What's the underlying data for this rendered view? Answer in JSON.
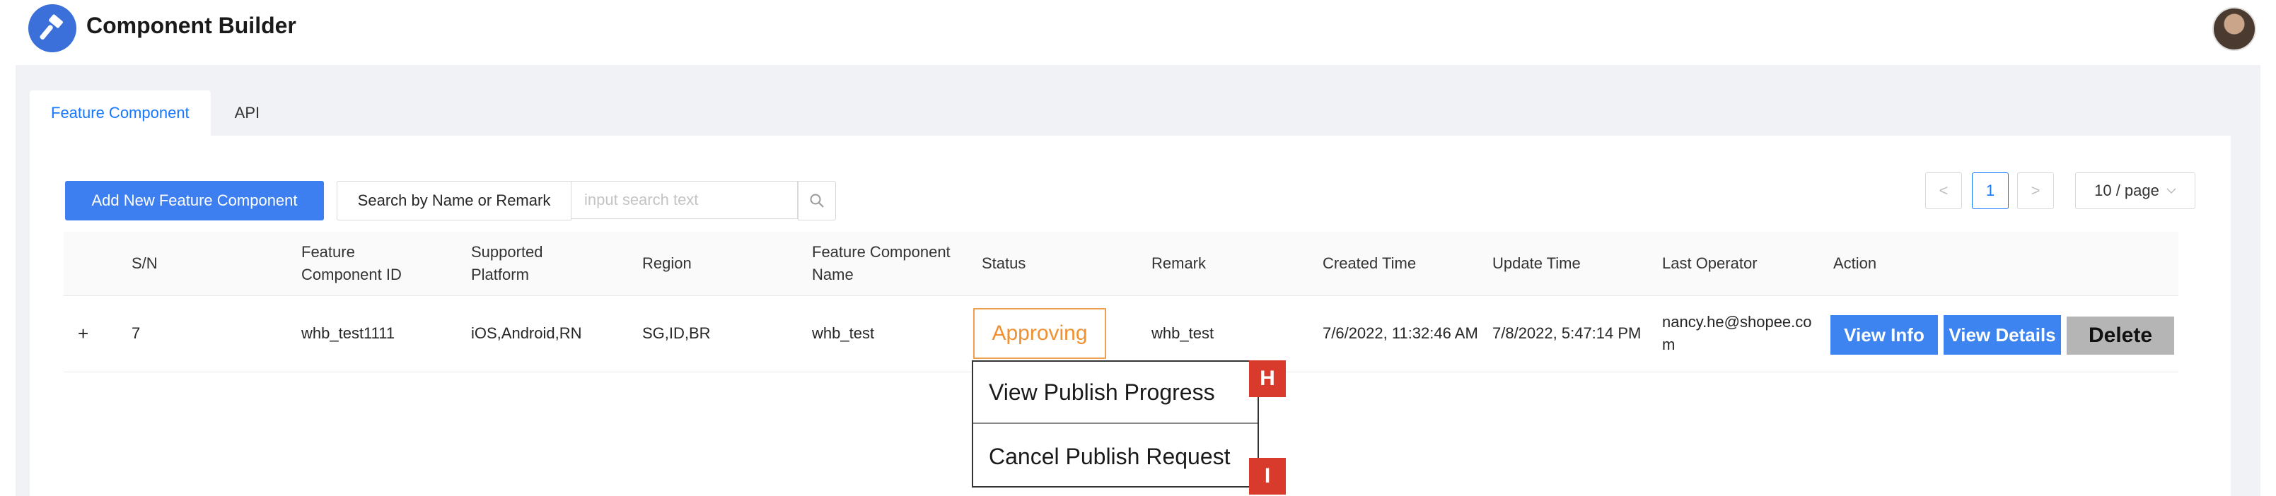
{
  "app": {
    "title": "Component Builder"
  },
  "tabs": [
    {
      "label": "Feature Component",
      "active": true
    },
    {
      "label": "API",
      "active": false
    }
  ],
  "toolbar": {
    "add_button": "Add New Feature Component",
    "search_label": "Search by Name or Remark",
    "search_placeholder": "input search text"
  },
  "pagination": {
    "prev": "<",
    "current_page": "1",
    "next": ">",
    "page_size": "10 / page"
  },
  "table": {
    "columns": [
      "S/N",
      "Feature Component ID",
      "Supported Platform",
      "Region",
      "Feature Component Name",
      "Status",
      "Remark",
      "Created Time",
      "Update Time",
      "Last Operator",
      "Action"
    ],
    "rows": [
      {
        "expand": "+",
        "sn": "7",
        "component_id": "whb_test1111",
        "platform": "iOS,Android,RN",
        "region": "SG,ID,BR",
        "name": "whb_test",
        "status": "Approving",
        "remark": "whb_test",
        "created": "7/6/2022, 11:32:46 AM",
        "updated": "7/8/2022, 5:47:14 PM",
        "operator": "nancy.he@shopee.com",
        "actions": {
          "view_info": "View Info",
          "view_details": "View Details",
          "delete": "Delete"
        }
      }
    ]
  },
  "status_menu": {
    "items": [
      {
        "label": "View Publish Progress",
        "marker": "H"
      },
      {
        "label": "Cancel Publish Request",
        "marker": "I"
      }
    ]
  },
  "colors": {
    "primary": "#3d7ef0",
    "status_border": "#f0a050",
    "marker": "#d83a2c"
  },
  "icons": [
    "hammer-icon",
    "search-icon",
    "chevron-down-icon",
    "avatar"
  ]
}
